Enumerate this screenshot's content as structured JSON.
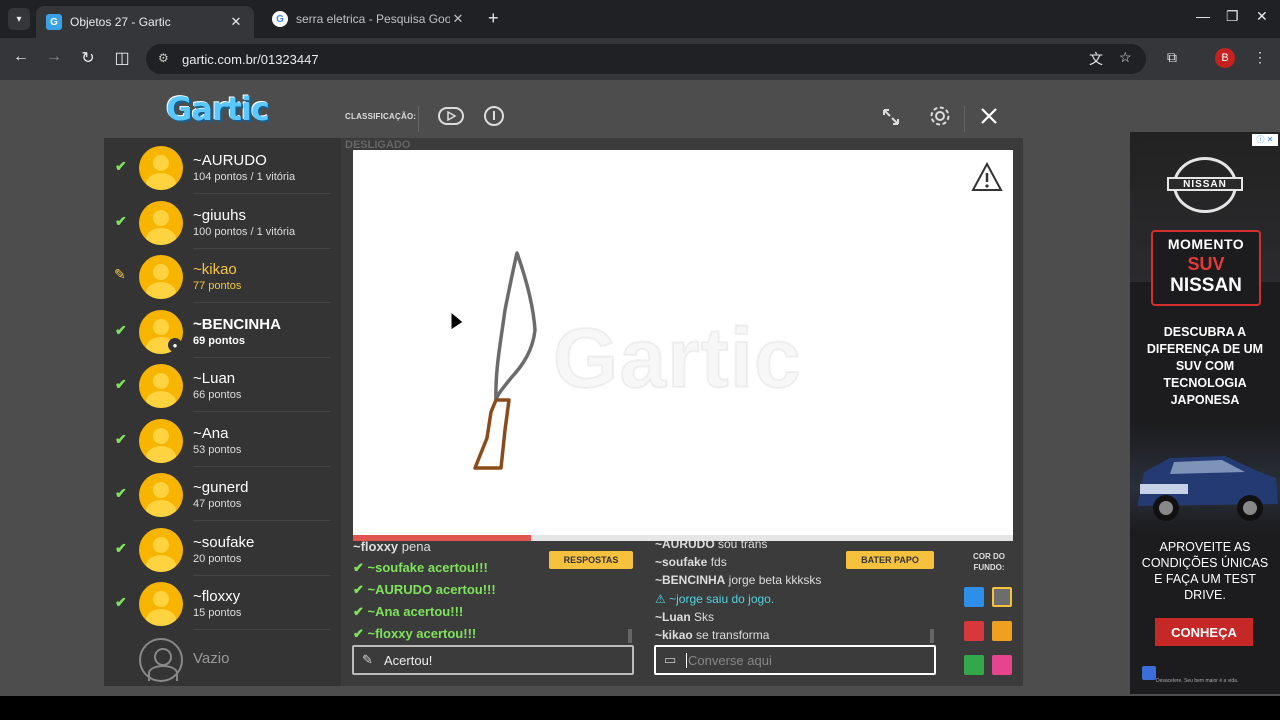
{
  "browser": {
    "tabs": [
      {
        "title": "Objetos 27 - Gartic",
        "active": true
      },
      {
        "title": "serra eletrica - Pesquisa Goo",
        "active": false
      }
    ],
    "url": "gartic.com.br/01323447",
    "profile_initial": "B"
  },
  "header": {
    "logo": "Gartic",
    "classificacao": "CLASSIFICAÇÃO:",
    "status": "DESLIGADO"
  },
  "players": [
    {
      "name": "~AURUDO",
      "score": "104 pontos / 1 vitória",
      "state": "guessed"
    },
    {
      "name": "~giuuhs",
      "score": "100 pontos / 1 vitória",
      "state": "guessed"
    },
    {
      "name": "~kikao",
      "score": "77 pontos",
      "state": "drawing"
    },
    {
      "name": "~BENCINHA",
      "score": "69 pontos",
      "state": "guessed",
      "me": true
    },
    {
      "name": "~Luan",
      "score": "66 pontos",
      "state": "guessed"
    },
    {
      "name": "~Ana",
      "score": "53 pontos",
      "state": "guessed"
    },
    {
      "name": "~gunerd",
      "score": "47 pontos",
      "state": "guessed"
    },
    {
      "name": "~soufake",
      "score": "20 pontos",
      "state": "guessed"
    },
    {
      "name": "~floxxy",
      "score": "15 pontos",
      "state": "guessed"
    }
  ],
  "empty_slot": "Vazio",
  "canvas": {
    "watermark": "Gartic",
    "timer_fraction": 0.27
  },
  "answers": {
    "button": "RESPOSTAS",
    "first_user": "~floxxy",
    "first_text": " pena",
    "lines": [
      "~soufake acertou!!!",
      "~AURUDO acertou!!!",
      "~Ana acertou!!!",
      "~floxxy acertou!!!"
    ],
    "input_value": "Acertou!"
  },
  "chat": {
    "button": "BATER PAPO",
    "lines": [
      {
        "user": "~AURUDO",
        "text": " sou trans"
      },
      {
        "user": "~soufake",
        "text": " fds"
      },
      {
        "user": "~BENCINHA",
        "text": " jorge beta kkksks"
      },
      {
        "system": "~jorge saiu do jogo."
      },
      {
        "user": "~Luan",
        "text": " Sks"
      },
      {
        "user": "~kikao",
        "text": " se transforma"
      }
    ],
    "placeholder": "Converse aqui"
  },
  "background_colors": {
    "title": "COR DO FUNDO:",
    "swatches": [
      "#2d8fe9",
      "#6d6d6d",
      "#d8383a",
      "#f0a020",
      "#33a84a",
      "#e8438f"
    ]
  },
  "ad": {
    "brand": "NISSAN",
    "line1": "MOMENTO",
    "line2": "SUV",
    "line3": "NISSAN",
    "text1": "DESCUBRA A DIFERENÇA DE UM SUV COM TECNOLOGIA JAPONESA",
    "text2": "APROVEITE AS CONDIÇÕES ÚNICAS E FAÇA UM TEST DRIVE.",
    "cta": "CONHEÇA",
    "footer": "Desacelere. Seu bem maior é a vida."
  }
}
